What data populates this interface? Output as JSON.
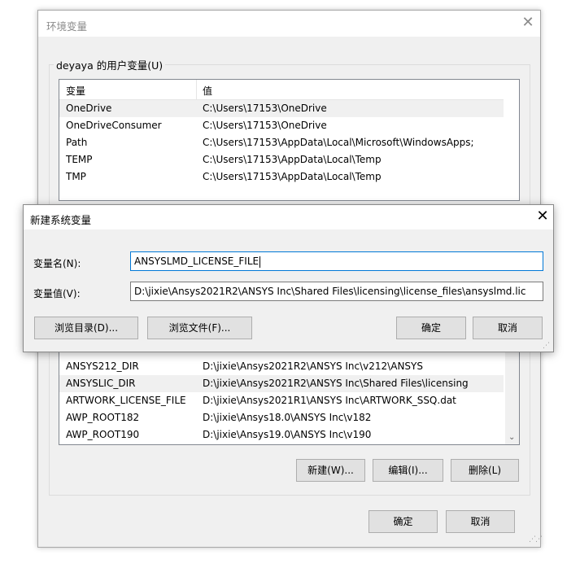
{
  "main_window": {
    "title": "环境变量",
    "user_group_label": "deyaya 的用户变量(U)",
    "user_columns": {
      "name": "变量",
      "value": "值"
    },
    "user_rows": [
      {
        "name": "OneDrive",
        "value": "C:\\Users\\17153\\OneDrive",
        "selected": true
      },
      {
        "name": "OneDriveConsumer",
        "value": "C:\\Users\\17153\\OneDrive"
      },
      {
        "name": "Path",
        "value": "C:\\Users\\17153\\AppData\\Local\\Microsoft\\WindowsApps;"
      },
      {
        "name": "TEMP",
        "value": "C:\\Users\\17153\\AppData\\Local\\Temp"
      },
      {
        "name": "TMP",
        "value": "C:\\Users\\17153\\AppData\\Local\\Temp"
      }
    ],
    "sys_rows": [
      {
        "name": "ANSYS212_DIR",
        "value": "D:\\jixie\\Ansys2021R2\\ANSYS Inc\\v212\\ANSYS"
      },
      {
        "name": "ANSYSLIC_DIR",
        "value": "D:\\jixie\\Ansys2021R2\\ANSYS Inc\\Shared Files\\licensing",
        "selected": true
      },
      {
        "name": "ARTWORK_LICENSE_FILE",
        "value": "D:\\jixie\\Ansys2021R1\\ANSYS Inc\\ARTWORK_SSQ.dat"
      },
      {
        "name": "AWP_ROOT182",
        "value": "D:\\jixie\\Ansys18.0\\ANSYS Inc\\v182"
      },
      {
        "name": "AWP_ROOT190",
        "value": "D:\\jixie\\Ansys19.0\\ANSYS Inc\\v190"
      }
    ],
    "sys_buttons": {
      "new": "新建(W)...",
      "edit": "编辑(I)...",
      "delete": "删除(L)"
    },
    "ok": "确定",
    "cancel": "取消",
    "close_glyph": "✕"
  },
  "dialog": {
    "title": "新建系统变量",
    "name_label": "变量名(N):",
    "name_value": "ANSYSLMD_LICENSE_FILE",
    "value_label": "变量值(V):",
    "value_value": "D:\\jixie\\Ansys2021R2\\ANSYS Inc\\Shared Files\\licensing\\license_files\\ansyslmd.lic",
    "browse_dir": "浏览目录(D)...",
    "browse_file": "浏览文件(F)...",
    "ok": "确定",
    "cancel": "取消",
    "close_glyph": "✕"
  },
  "icons": {
    "scroll_down": "chevron-down-icon",
    "resize": "resize-grip-icon",
    "close": "close-icon"
  },
  "colors": {
    "accent": "#0078d7",
    "window_bg": "#f0f0f0",
    "border": "#adadad"
  }
}
